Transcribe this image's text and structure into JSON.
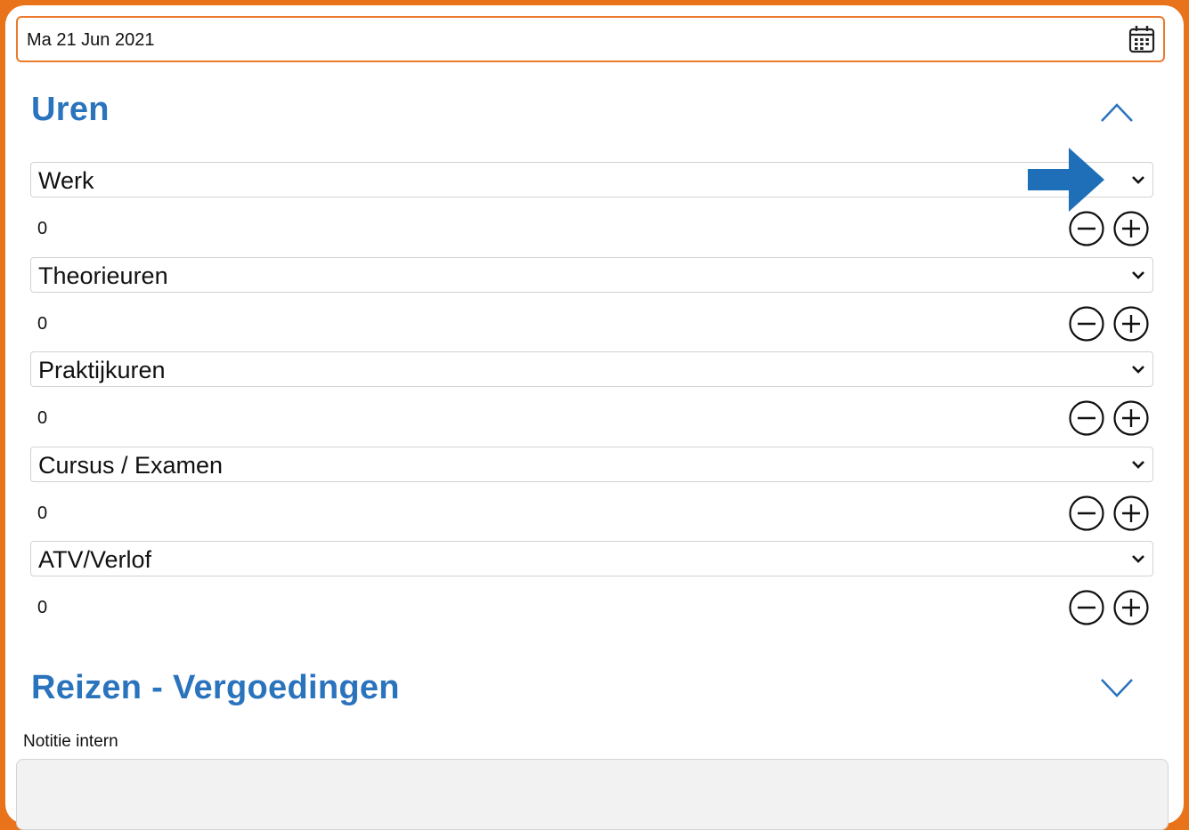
{
  "colors": {
    "frame": "#e8731a",
    "accent_border": "#ec7a2d",
    "heading": "#2a73bd",
    "arrow": "#1e6fb8"
  },
  "date_field": {
    "value": "Ma 21 Jun 2021",
    "icon": "calendar-icon"
  },
  "uren": {
    "title": "Uren",
    "collapse_icon": "chevron-up-icon",
    "rows": [
      {
        "label": "Werk",
        "value": "0"
      },
      {
        "label": "Theorieuren",
        "value": "0"
      },
      {
        "label": "Praktijkuren",
        "value": "0"
      },
      {
        "label": "Cursus / Examen",
        "value": "0"
      },
      {
        "label": "ATV/Verlof",
        "value": "0"
      }
    ],
    "decrement_icon": "minus-circle-icon",
    "increment_icon": "plus-circle-icon",
    "pointer_icon": "arrow-right-icon"
  },
  "reizen": {
    "title": "Reizen - Vergoedingen",
    "expand_icon": "chevron-down-icon"
  },
  "notitie": {
    "label": "Notitie intern",
    "value": ""
  }
}
